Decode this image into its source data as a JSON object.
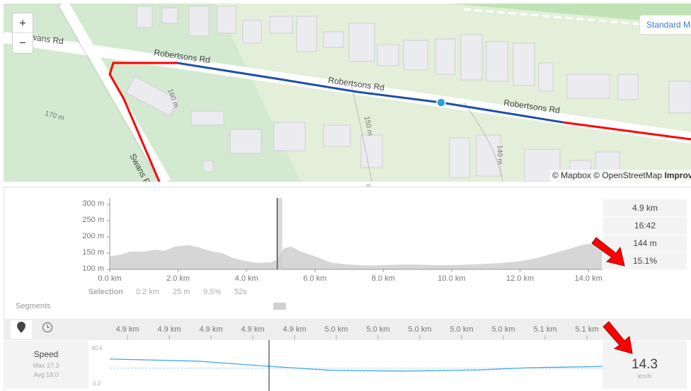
{
  "map": {
    "zoom_in": "+",
    "zoom_out": "−",
    "style_button": "Standard Map",
    "attribution": "© Mapbox © OpenStreetMap",
    "attribution_link": "Improve this map",
    "road_labels": [
      "Swans Rd",
      "Robertsons Rd",
      "Robertsons Rd",
      "Robertsons Rd",
      "Swans Rd"
    ],
    "contour_labels": [
      "160 m",
      "170 m",
      "150 m",
      "140 m"
    ],
    "route_colors": {
      "route": "#ff0000",
      "selection": "#1f4fa8",
      "marker": "#2aa3d8"
    }
  },
  "elevation": {
    "chart_data": {
      "type": "area",
      "y_ticks": [
        "300 m",
        "250 m",
        "200 m",
        "150 m",
        "100 m"
      ],
      "x_ticks": [
        "0.0 km",
        "2.0 km",
        "4.0 km",
        "6.0 km",
        "8.0 km",
        "10.0 km",
        "12.0 km",
        "14.0 km"
      ],
      "ylim": [
        100,
        300
      ],
      "xlim": [
        0,
        14.4
      ],
      "x": [
        0,
        0.3,
        0.6,
        1.0,
        1.3,
        1.6,
        1.9,
        2.3,
        2.6,
        3.0,
        3.3,
        3.6,
        4.0,
        4.3,
        4.7,
        4.9,
        5.1,
        5.3,
        5.6,
        6.0,
        6.5,
        7.0,
        7.5,
        8.0,
        8.5,
        9.0,
        9.5,
        10.0,
        10.5,
        11.0,
        11.5,
        12.0,
        12.5,
        13.0,
        13.5,
        13.8,
        14.0,
        14.4
      ],
      "y": [
        140,
        145,
        155,
        155,
        160,
        157,
        170,
        175,
        168,
        155,
        150,
        135,
        125,
        120,
        122,
        130,
        165,
        170,
        155,
        140,
        120,
        115,
        112,
        113,
        115,
        115,
        113,
        113,
        115,
        117,
        120,
        125,
        135,
        150,
        165,
        175,
        178,
        175
      ],
      "cursor_km": 4.9,
      "fill": "#d6d6d6"
    },
    "stats": [
      "4.9 km",
      "16:42",
      "144 m",
      "15.1%"
    ],
    "selection": {
      "label": "Selection",
      "distance": "0.2 km",
      "gain": "25 m",
      "grade": "9.5%",
      "time": "52s"
    },
    "segments_label": "Segments"
  },
  "detail": {
    "tools": [
      "pin-icon",
      "clock-icon"
    ],
    "km_ticks": [
      "4.9 km",
      "4.9 km",
      "4.9 km",
      "4.9 km",
      "4.9 km",
      "5.0 km",
      "5.0 km",
      "5.0 km",
      "5.0 km",
      "5.0 km",
      "5.1 km",
      "5.1 km"
    ],
    "speed": {
      "label": "Speed",
      "max": "Max 27.3",
      "avg": "Avg 18.0",
      "ymax": "40.4",
      "ymin": "0.0",
      "value": "14.3",
      "unit": "km/h",
      "chart_data": {
        "type": "line",
        "ylim": [
          0,
          40.4
        ],
        "x": [
          0,
          0.18,
          0.3,
          0.45,
          0.6,
          0.75,
          0.85,
          1.0
        ],
        "y": [
          28.5,
          26,
          21,
          15.5,
          14.7,
          16,
          18.5,
          20
        ],
        "avg": 18.0,
        "color": "#4aa8e8"
      }
    }
  }
}
